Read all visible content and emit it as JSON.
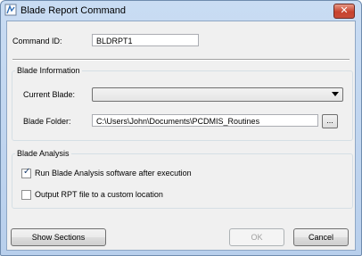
{
  "window": {
    "title": "Blade Report Command",
    "close_glyph": "✕"
  },
  "command": {
    "label": "Command ID:",
    "value": "BLDRPT1"
  },
  "blade_information": {
    "title": "Blade Information",
    "current_blade_label": "Current Blade:",
    "current_blade_value": "",
    "folder_label": "Blade Folder:",
    "folder_value": "C:\\Users\\John\\Documents\\PCDMIS_Routines",
    "browse_label": "..."
  },
  "blade_analysis": {
    "title": "Blade Analysis",
    "run_label": "Run Blade Analysis software after execution",
    "run_checked": true,
    "output_label": "Output RPT file to a custom location",
    "output_checked": false
  },
  "buttons": {
    "show_sections": "Show Sections",
    "ok": "OK",
    "cancel": "Cancel"
  },
  "icons": {
    "app": "blade-report-icon",
    "close": "close-icon",
    "dropdown": "chevron-down-icon"
  },
  "colors": {
    "titlebar": "#c9dcf3",
    "close": "#c7422e",
    "client": "#f0f0f0"
  }
}
